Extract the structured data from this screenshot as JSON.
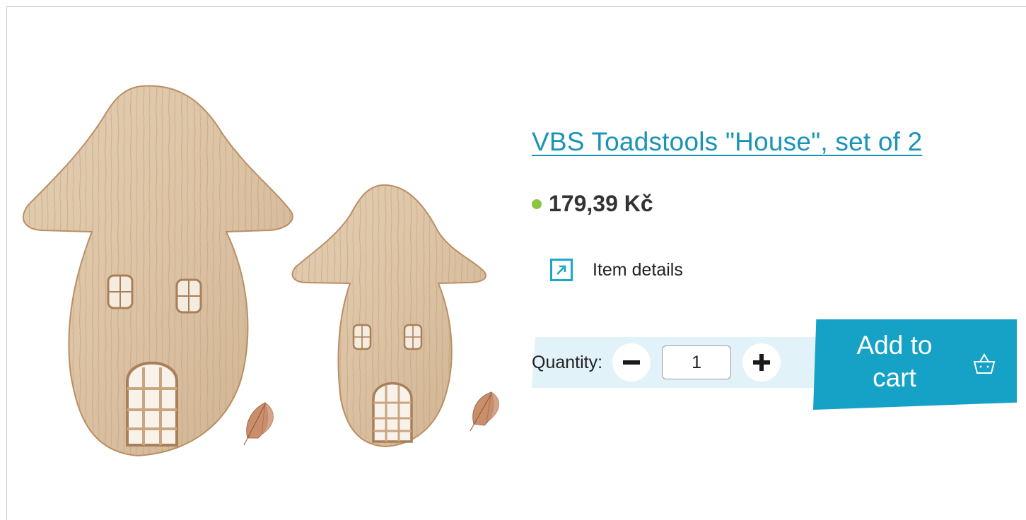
{
  "product": {
    "title": "VBS Toadstools \"House\", set of 2",
    "price": "179,39 Kč",
    "stock_color": "#8cc63f"
  },
  "details": {
    "label": "Item details",
    "icon": "external-arrow-icon"
  },
  "quantity": {
    "label": "Quantity:",
    "value": "1",
    "minus_icon": "minus-icon",
    "plus_icon": "plus-icon"
  },
  "cart": {
    "label": "Add to\ncart",
    "icon": "basket-icon"
  },
  "colors": {
    "accent": "#15a2c6",
    "link": "#1a94b6",
    "quantity_band": "#e1f2f8"
  }
}
